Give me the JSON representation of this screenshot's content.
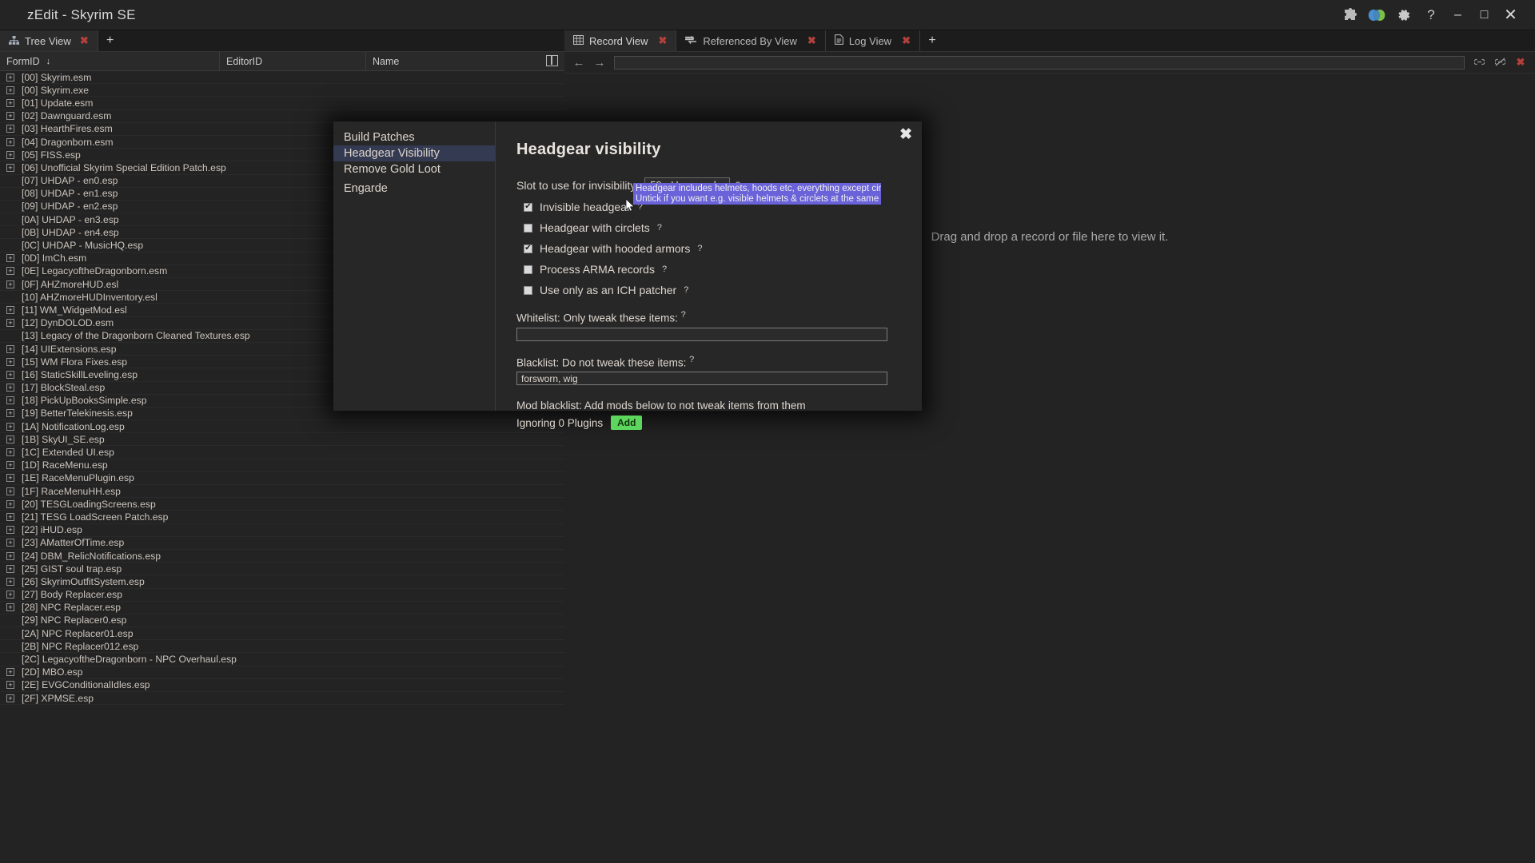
{
  "window": {
    "title": "zEdit - Skyrim SE",
    "toolbar_icons": [
      "puzzle-icon",
      "masks-icon",
      "gear-icon",
      "help-icon"
    ],
    "controls": {
      "minimize": "–",
      "maximize": "□",
      "close": "✕"
    }
  },
  "left_panel": {
    "tabs": [
      {
        "label": "Tree View",
        "icon": "tree-icon",
        "close": "✖"
      }
    ],
    "add_tab": "+",
    "columns": [
      {
        "label": "FormID",
        "sort": "↓"
      },
      {
        "label": "EditorID",
        "sort": ""
      },
      {
        "label": "Name",
        "sort": ""
      }
    ],
    "rows": [
      {
        "label": "[00] Skyrim.esm",
        "expandable": true,
        "indent": 0
      },
      {
        "label": "[00] Skyrim.exe",
        "expandable": true,
        "indent": 0
      },
      {
        "label": "[01] Update.esm",
        "expandable": true,
        "indent": 0
      },
      {
        "label": "[02] Dawnguard.esm",
        "expandable": true,
        "indent": 0
      },
      {
        "label": "[03] HearthFires.esm",
        "expandable": true,
        "indent": 0
      },
      {
        "label": "[04] Dragonborn.esm",
        "expandable": true,
        "indent": 0
      },
      {
        "label": "[05] FISS.esp",
        "expandable": true,
        "indent": 0
      },
      {
        "label": "[06] Unofficial Skyrim Special Edition Patch.esp",
        "expandable": true,
        "indent": 0
      },
      {
        "label": "[07] UHDAP - en0.esp",
        "expandable": false,
        "indent": 0
      },
      {
        "label": "[08] UHDAP - en1.esp",
        "expandable": false,
        "indent": 0
      },
      {
        "label": "[09] UHDAP - en2.esp",
        "expandable": false,
        "indent": 0
      },
      {
        "label": "[0A] UHDAP - en3.esp",
        "expandable": false,
        "indent": 0
      },
      {
        "label": "[0B] UHDAP - en4.esp",
        "expandable": false,
        "indent": 0
      },
      {
        "label": "[0C] UHDAP - MusicHQ.esp",
        "expandable": false,
        "indent": 0
      },
      {
        "label": "[0D] ImCh.esm",
        "expandable": true,
        "indent": 0
      },
      {
        "label": "[0E] LegacyoftheDragonborn.esm",
        "expandable": true,
        "indent": 0
      },
      {
        "label": "[0F] AHZmoreHUD.esl",
        "expandable": true,
        "indent": 0
      },
      {
        "label": "[10] AHZmoreHUDInventory.esl",
        "expandable": false,
        "indent": 0
      },
      {
        "label": "[11] WM_WidgetMod.esl",
        "expandable": true,
        "indent": 0
      },
      {
        "label": "[12] DynDOLOD.esm",
        "expandable": true,
        "indent": 0
      },
      {
        "label": "[13] Legacy of the Dragonborn Cleaned Textures.esp",
        "expandable": false,
        "indent": 0
      },
      {
        "label": "[14] UIExtensions.esp",
        "expandable": true,
        "indent": 0
      },
      {
        "label": "[15] WM Flora Fixes.esp",
        "expandable": true,
        "indent": 0
      },
      {
        "label": "[16] StaticSkillLeveling.esp",
        "expandable": true,
        "indent": 0
      },
      {
        "label": "[17] BlockSteal.esp",
        "expandable": true,
        "indent": 0
      },
      {
        "label": "[18] PickUpBooksSimple.esp",
        "expandable": true,
        "indent": 0
      },
      {
        "label": "[19] BetterTelekinesis.esp",
        "expandable": true,
        "indent": 0
      },
      {
        "label": "[1A] NotificationLog.esp",
        "expandable": true,
        "indent": 0
      },
      {
        "label": "[1B] SkyUI_SE.esp",
        "expandable": true,
        "indent": 0
      },
      {
        "label": "[1C] Extended UI.esp",
        "expandable": true,
        "indent": 0
      },
      {
        "label": "[1D] RaceMenu.esp",
        "expandable": true,
        "indent": 0
      },
      {
        "label": "[1E] RaceMenuPlugin.esp",
        "expandable": true,
        "indent": 0
      },
      {
        "label": "[1F] RaceMenuHH.esp",
        "expandable": true,
        "indent": 0
      },
      {
        "label": "[20] TESGLoadingScreens.esp",
        "expandable": true,
        "indent": 0
      },
      {
        "label": "[21] TESG LoadScreen Patch.esp",
        "expandable": true,
        "indent": 0
      },
      {
        "label": "[22] iHUD.esp",
        "expandable": true,
        "indent": 0
      },
      {
        "label": "[23] AMatterOfTime.esp",
        "expandable": true,
        "indent": 0
      },
      {
        "label": "[24] DBM_RelicNotifications.esp",
        "expandable": true,
        "indent": 0
      },
      {
        "label": "[25] GIST soul trap.esp",
        "expandable": true,
        "indent": 0
      },
      {
        "label": "[26] SkyrimOutfitSystem.esp",
        "expandable": true,
        "indent": 0
      },
      {
        "label": "[27] Body Replacer.esp",
        "expandable": true,
        "indent": 0
      },
      {
        "label": "[28] NPC Replacer.esp",
        "expandable": true,
        "indent": 0
      },
      {
        "label": "[29] NPC Replacer0.esp",
        "expandable": false,
        "indent": 0
      },
      {
        "label": "[2A] NPC Replacer01.esp",
        "expandable": false,
        "indent": 0
      },
      {
        "label": "[2B] NPC Replacer012.esp",
        "expandable": false,
        "indent": 0
      },
      {
        "label": "[2C] LegacyoftheDragonborn - NPC Overhaul.esp",
        "expandable": false,
        "indent": 0
      },
      {
        "label": "[2D] MBO.esp",
        "expandable": true,
        "indent": 0
      },
      {
        "label": "[2E] EVGConditionalIdles.esp",
        "expandable": true,
        "indent": 0
      },
      {
        "label": "[2F] XPMSE.esp",
        "expandable": true,
        "indent": 0
      }
    ]
  },
  "right_panel": {
    "tabs": [
      {
        "label": "Record View",
        "icon": "grid-icon",
        "active": true,
        "close": "✖"
      },
      {
        "label": "Referenced By View",
        "icon": "refs-icon",
        "active": false,
        "close": "✖"
      },
      {
        "label": "Log View",
        "icon": "document-icon",
        "active": false,
        "close": "✖"
      }
    ],
    "add_tab": "+",
    "nav": {
      "back": "←",
      "forward": "→",
      "path_value": "",
      "icons": [
        "link-icon",
        "no-link-icon",
        "close-icon"
      ]
    },
    "placeholder": "Drag and drop a record or file here to view it."
  },
  "modal": {
    "close": "✖",
    "nav_items": [
      {
        "label": "Build Patches",
        "active": false
      },
      {
        "label": "Headgear Visibility",
        "active": true
      },
      {
        "label": "Remove Gold Loot",
        "active": false
      },
      {
        "label": "Engarde",
        "active": false
      }
    ],
    "heading": "Headgear visibility",
    "slot_row": {
      "label": "Slot to use for invisibility:",
      "selected": "59 - Unnamed",
      "caret": "▼",
      "help": "?"
    },
    "checkboxes": [
      {
        "label": "Invisible headgear",
        "checked": true,
        "help": "?"
      },
      {
        "label": "Headgear with circlets",
        "checked": false,
        "help": "?"
      },
      {
        "label": "Headgear with hooded armors",
        "checked": true,
        "help": "?"
      },
      {
        "label": "Process ARMA records",
        "checked": false,
        "help": "?"
      },
      {
        "label": "Use only as an ICH patcher",
        "checked": false,
        "help": "?"
      }
    ],
    "whitelist": {
      "label": "Whitelist: Only tweak these items:",
      "help": "?",
      "value": "",
      "placeholder": ""
    },
    "blacklist": {
      "label": "Blacklist: Do not tweak these items:",
      "help": "?",
      "value": "forsworn, wig",
      "placeholder": ""
    },
    "mod_blacklist": {
      "description": "Mod blacklist: Add mods below to not tweak items from them",
      "status": "Ignoring 0 Plugins",
      "add_label": "Add"
    },
    "tooltip": {
      "line1": "Headgear includes helmets, hoods etc, everything except circlets",
      "line2": "Untick if you want e.g. visible helmets & circlets at the same time",
      "bg": "#6a62d8"
    }
  },
  "colors": {
    "accent_selected": "#343a52",
    "add_button": "#5cd65c",
    "tab_close_red": "#b4403c",
    "tooltip_bg": "#6a62d8"
  }
}
